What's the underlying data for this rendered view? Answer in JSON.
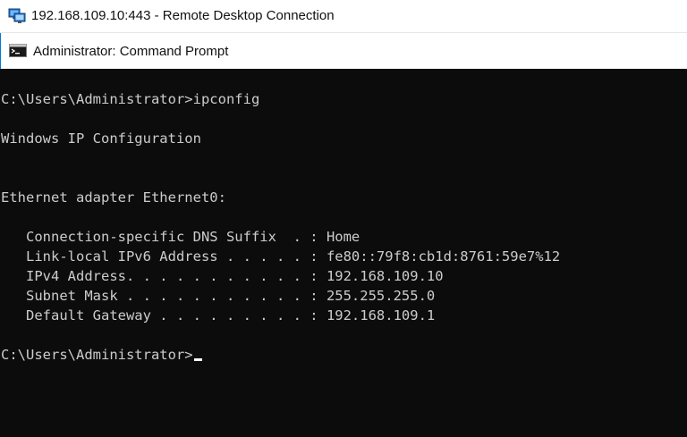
{
  "rdp_window": {
    "title": "192.168.109.10:443 - Remote Desktop Connection",
    "icon": "remote-desktop-icon"
  },
  "cmd_window": {
    "title": "Administrator: Command Prompt",
    "icon": "command-prompt-icon"
  },
  "console": {
    "command_line": "C:\\Users\\Administrator>ipconfig",
    "header": "Windows IP Configuration",
    "adapter_line": "Ethernet adapter Ethernet0:",
    "rows": [
      {
        "text": "   Connection-specific DNS Suffix  . : Home"
      },
      {
        "text": "   Link-local IPv6 Address . . . . . : fe80::79f8:cb1d:8761:59e7%12"
      },
      {
        "text": "   IPv4 Address. . . . . . . . . . . : 192.168.109.10"
      },
      {
        "text": "   Subnet Mask . . . . . . . . . . . : 255.255.255.0"
      },
      {
        "text": "   Default Gateway . . . . . . . . . : 192.168.109.1"
      }
    ],
    "prompt": "C:\\Users\\Administrator>"
  }
}
